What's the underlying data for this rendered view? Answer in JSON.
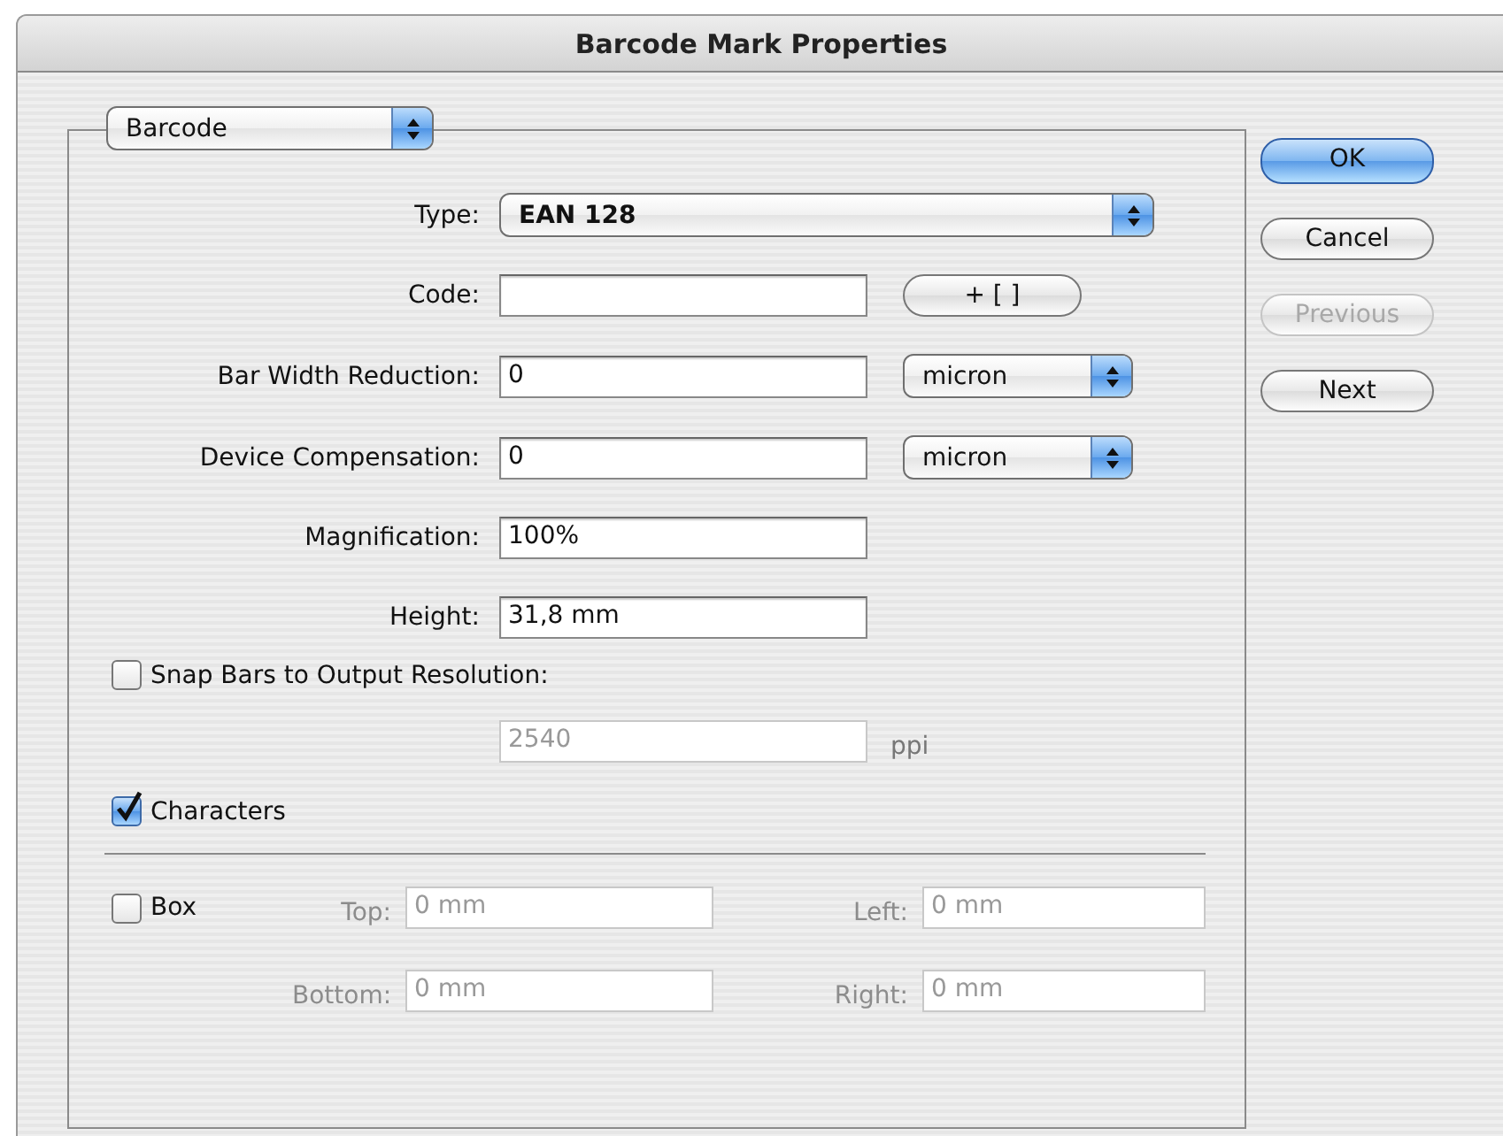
{
  "window": {
    "title": "Barcode Mark Properties"
  },
  "section_menu": {
    "value": "Barcode"
  },
  "rows": [
    {
      "kind": "popup",
      "label": "Type:",
      "value": "EAN 128"
    },
    {
      "kind": "text",
      "label": "Code:",
      "button": "+ [ ]"
    },
    {
      "kind": "text",
      "label": "Bar Width Reduction:",
      "value": "0",
      "unit": "micron"
    },
    {
      "kind": "text",
      "label": "Device Compensation:",
      "value": "0",
      "unit": "micron"
    },
    {
      "kind": "text",
      "label": "Magnification:",
      "value": "100%"
    },
    {
      "kind": "text",
      "label": "Height:",
      "value": "31,8 mm"
    }
  ],
  "snap": {
    "label": "Snap Bars to Output Resolution:",
    "checked": false,
    "resolution": {
      "value": "2540",
      "disabled": true
    },
    "unit": "ppi"
  },
  "characters": {
    "label": "Characters",
    "checked": true
  },
  "box": {
    "label": "Box",
    "checked": false,
    "fields": [
      {
        "label": "Top:",
        "value": "0 mm",
        "disabled": true
      },
      {
        "label": "Left:",
        "value": "0 mm",
        "disabled": true
      },
      {
        "label": "Bottom:",
        "value": "0 mm",
        "disabled": true
      },
      {
        "label": "Right:",
        "value": "0 mm",
        "disabled": true
      }
    ]
  },
  "buttons": [
    {
      "label": "OK",
      "kind": "default",
      "disabled": false
    },
    {
      "label": "Cancel",
      "kind": "normal",
      "disabled": false
    },
    {
      "label": "Previous",
      "kind": "normal",
      "disabled": true
    },
    {
      "label": "Next",
      "kind": "normal",
      "disabled": false
    }
  ]
}
